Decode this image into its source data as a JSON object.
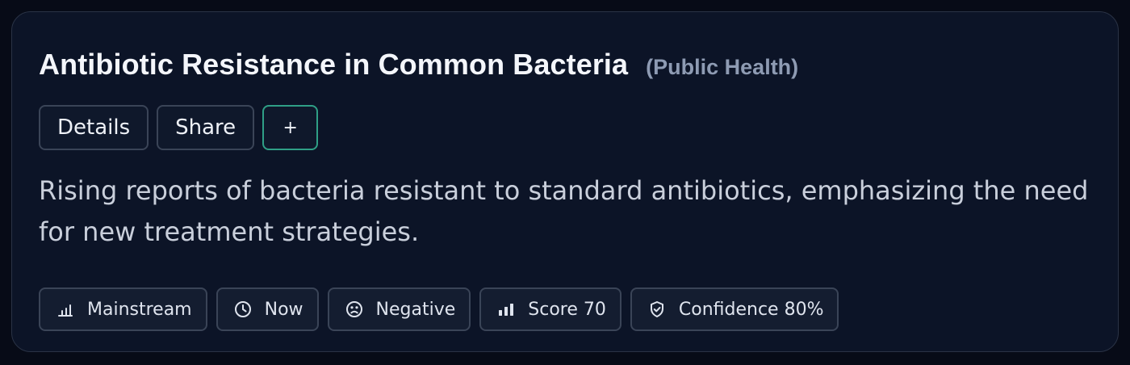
{
  "card": {
    "title": "Antibiotic Resistance in Common Bacteria",
    "category": "(Public Health)",
    "actions": {
      "details_label": "Details",
      "share_label": "Share",
      "add_label": "+"
    },
    "description": "Rising reports of bacteria resistant to standard antibiotics, emphasizing the need for new treatment strategies.",
    "meta": [
      {
        "icon": "bar-chart-icon",
        "label": "Mainstream"
      },
      {
        "icon": "clock-icon",
        "label": "Now"
      },
      {
        "icon": "frown-face-icon",
        "label": "Negative"
      },
      {
        "icon": "signal-bars-icon",
        "label": "Score 70"
      },
      {
        "icon": "shield-check-icon",
        "label": "Confidence 80%"
      }
    ]
  },
  "colors": {
    "page_background": "#070b17",
    "card_background": "#0c1427",
    "accent_border": "#2f9f86",
    "title_text": "#f4f6fb",
    "muted_text": "#8e9bb3"
  }
}
